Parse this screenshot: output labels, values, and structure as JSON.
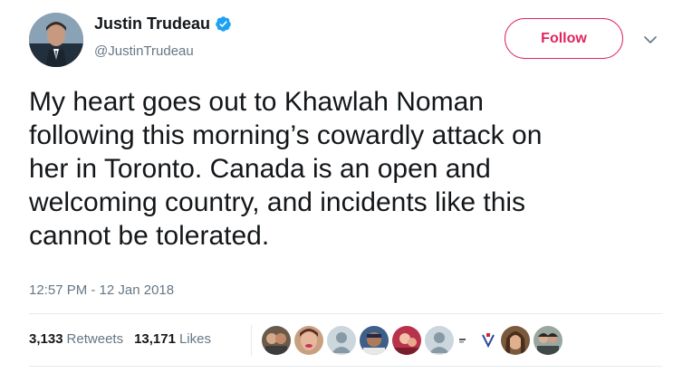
{
  "tweet": {
    "author_name": "Justin Trudeau",
    "handle": "@JustinTrudeau",
    "follow_label": "Follow",
    "text": "My heart goes out to Khawlah Noman\nfollowing this morning’s cowardly attack on\nher in Toronto. Canada is an open and\nwelcoming country, and incidents like this\ncannot be tolerated.",
    "timestamp": "12:57 PM - 12 Jan 2018",
    "retweets_count": "3,133",
    "retweets_label": "Retweets",
    "likes_count": "13,171",
    "likes_label": "Likes"
  },
  "icons": {
    "verified": "verified-badge-icon",
    "menu": "chevron-down-icon"
  },
  "colors": {
    "follow_accent": "#e0245e",
    "verified_blue": "#1da1f2",
    "secondary_text": "#657786",
    "primary_text": "#14171a",
    "divider": "#e6ecf0"
  }
}
